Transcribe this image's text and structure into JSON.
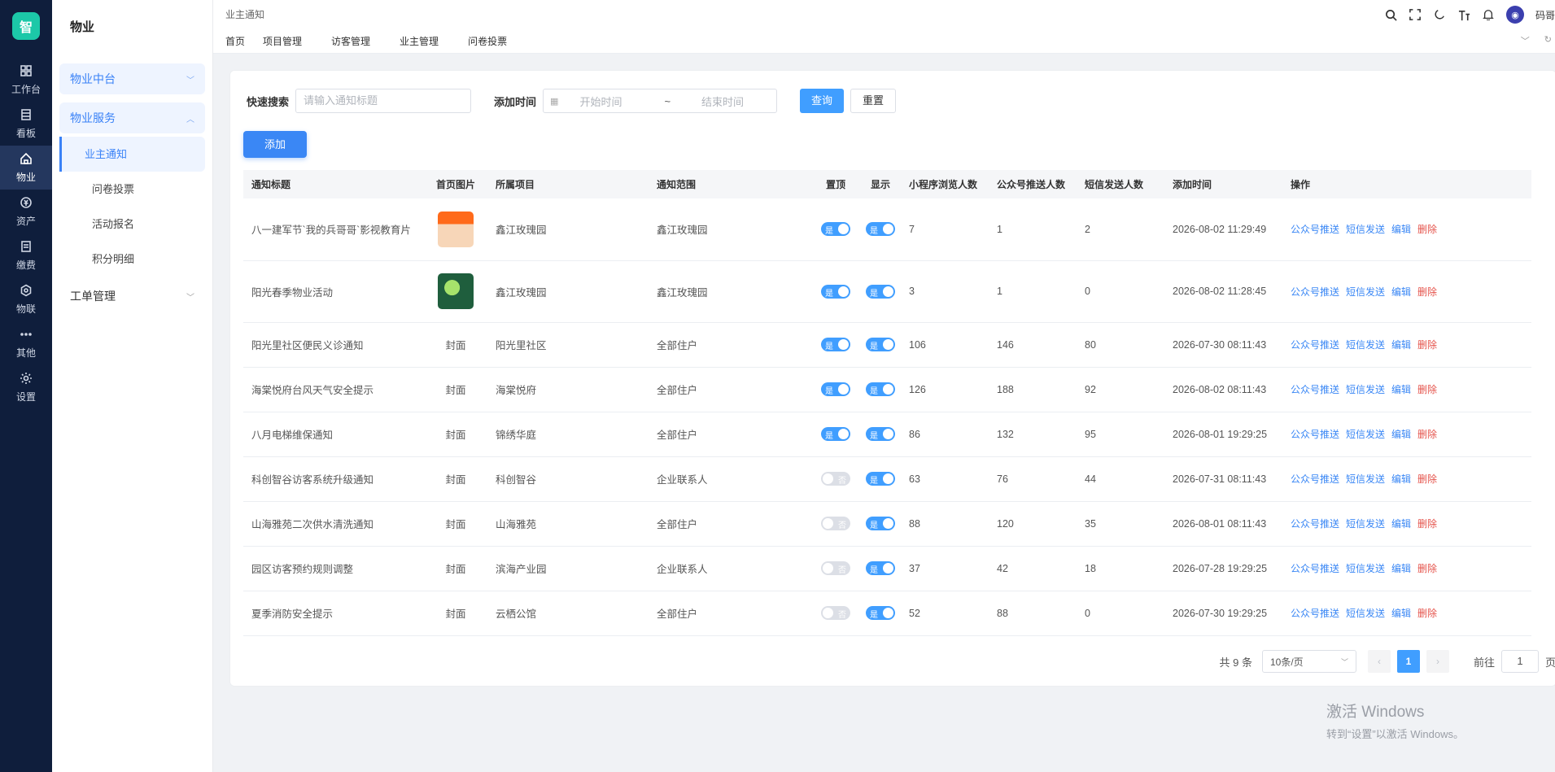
{
  "logo": "智",
  "rail": [
    {
      "label": "工作台",
      "icon": "grid-icon"
    },
    {
      "label": "看板",
      "icon": "board-icon"
    },
    {
      "label": "物业",
      "icon": "home-icon"
    },
    {
      "label": "资产",
      "icon": "money-icon"
    },
    {
      "label": "缴费",
      "icon": "bill-icon"
    },
    {
      "label": "物联",
      "icon": "hexagon-icon"
    },
    {
      "label": "其他",
      "icon": "more-icon"
    },
    {
      "label": "设置",
      "icon": "gear-icon"
    }
  ],
  "menu": {
    "title": "物业",
    "groups": [
      {
        "label": "物业中台"
      },
      {
        "label": "物业服务"
      }
    ],
    "sub_items": [
      "业主通知",
      "问卷投票",
      "活动报名",
      "积分明细"
    ],
    "group3": "工单管理"
  },
  "header": {
    "breadcrumb": "业主通知",
    "tabs": [
      "首页",
      "项目管理",
      "访客管理",
      "业主管理",
      "问卷投票"
    ],
    "user": "码哥"
  },
  "search": {
    "quick_label": "快速搜索",
    "quick_placeholder": "请输入通知标题",
    "time_label": "添加时间",
    "start_placeholder": "开始时间",
    "range_sep": "~",
    "end_placeholder": "结束时间",
    "query_btn": "查询",
    "reset_btn": "重置"
  },
  "add_btn": "添加",
  "table": {
    "headers": [
      "通知标题",
      "首页图片",
      "所属项目",
      "通知范围",
      "置顶",
      "显示",
      "小程序浏览人数",
      "公众号推送人数",
      "短信发送人数",
      "添加时间",
      "操作"
    ],
    "cover_text": "封面",
    "switch_on": "是",
    "switch_off": "否",
    "ops": [
      "公众号推送",
      "短信发送",
      "编辑",
      "删除"
    ],
    "rows": [
      {
        "title": "八一建军节`我的兵哥哥`影视教育片",
        "image": "thumb1",
        "project": "鑫江玫瑰园",
        "scope": "鑫江玫瑰园",
        "top": true,
        "show": true,
        "mini": "7",
        "mp": "1",
        "sms": "2",
        "time": "2026-08-02 11:29:49"
      },
      {
        "title": "阳光春季物业活动",
        "image": "thumb2",
        "project": "鑫江玫瑰园",
        "scope": "鑫江玫瑰园",
        "top": true,
        "show": true,
        "mini": "3",
        "mp": "1",
        "sms": "0",
        "time": "2026-08-02 11:28:45"
      },
      {
        "title": "阳光里社区便民义诊通知",
        "image": "",
        "project": "阳光里社区",
        "scope": "全部住户",
        "top": true,
        "show": true,
        "mini": "106",
        "mp": "146",
        "sms": "80",
        "time": "2026-07-30 08:11:43"
      },
      {
        "title": "海棠悦府台风天气安全提示",
        "image": "",
        "project": "海棠悦府",
        "scope": "全部住户",
        "top": true,
        "show": true,
        "mini": "126",
        "mp": "188",
        "sms": "92",
        "time": "2026-08-02 08:11:43"
      },
      {
        "title": "八月电梯维保通知",
        "image": "",
        "project": "锦绣华庭",
        "scope": "全部住户",
        "top": true,
        "show": true,
        "mini": "86",
        "mp": "132",
        "sms": "95",
        "time": "2026-08-01 19:29:25"
      },
      {
        "title": "科创智谷访客系统升级通知",
        "image": "",
        "project": "科创智谷",
        "scope": "企业联系人",
        "top": false,
        "show": true,
        "mini": "63",
        "mp": "76",
        "sms": "44",
        "time": "2026-07-31 08:11:43"
      },
      {
        "title": "山海雅苑二次供水清洗通知",
        "image": "",
        "project": "山海雅苑",
        "scope": "全部住户",
        "top": false,
        "show": true,
        "mini": "88",
        "mp": "120",
        "sms": "35",
        "time": "2026-08-01 08:11:43"
      },
      {
        "title": "园区访客预约规则调整",
        "image": "",
        "project": "滨海产业园",
        "scope": "企业联系人",
        "top": false,
        "show": true,
        "mini": "37",
        "mp": "42",
        "sms": "18",
        "time": "2026-07-28 19:29:25"
      },
      {
        "title": "夏季消防安全提示",
        "image": "",
        "project": "云栖公馆",
        "scope": "全部住户",
        "top": false,
        "show": true,
        "mini": "52",
        "mp": "88",
        "sms": "0",
        "time": "2026-07-30 19:29:25"
      }
    ]
  },
  "pager": {
    "total": "共 9 条",
    "size": "10条/页",
    "current": "1",
    "goto_label": "前往",
    "goto_value": "1",
    "page_suffix": "页"
  },
  "watermark": {
    "line1": "激活 Windows",
    "line2": "转到“设置”以激活 Windows。"
  },
  "colors": {
    "rail_bg": "#0f1e3c",
    "accent": "#409eff",
    "danger": "#e5534b",
    "logo": "#1cc8a8"
  }
}
